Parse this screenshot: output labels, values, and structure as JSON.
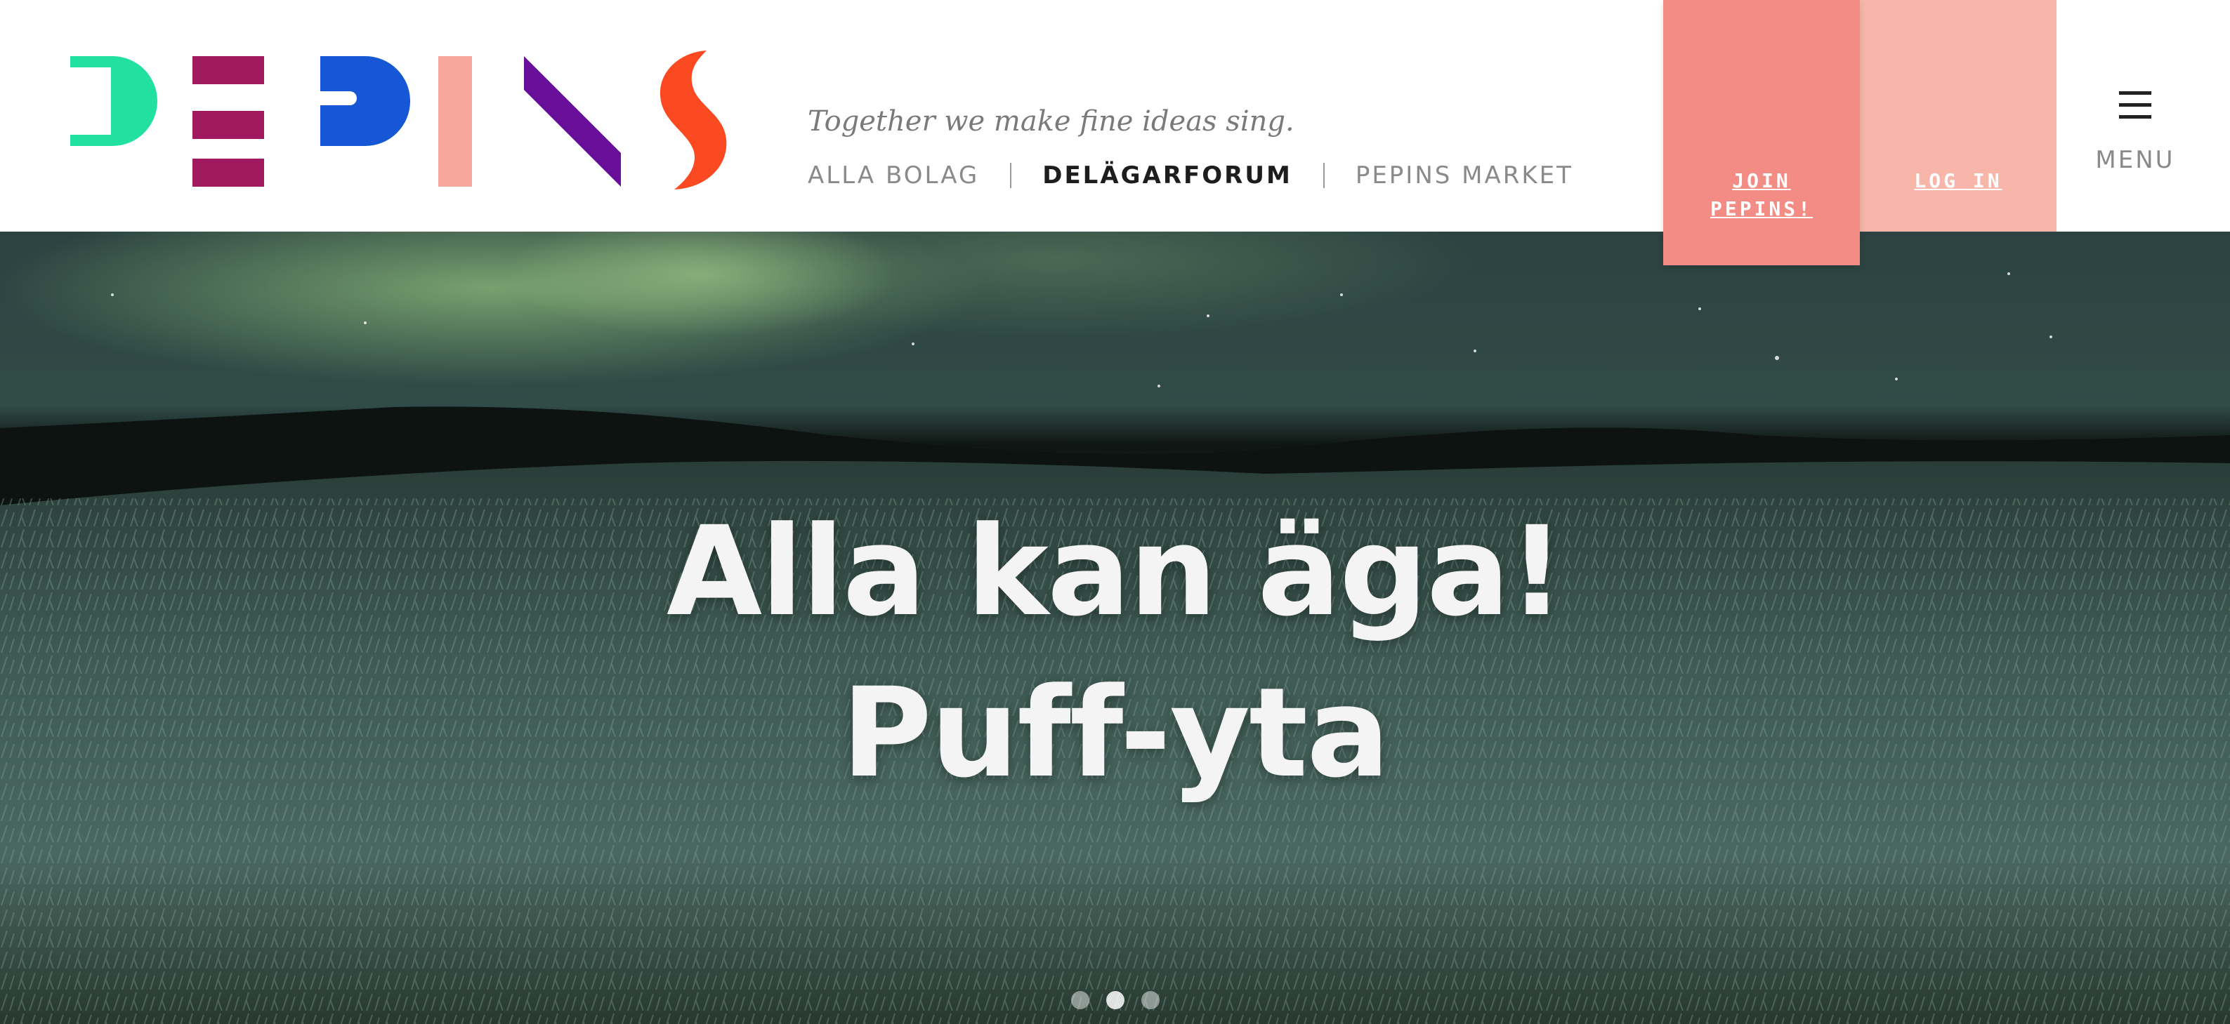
{
  "brand": {
    "logo_text": "PEPINS",
    "colors": {
      "p1": "#22e0a0",
      "e": "#a11a5f",
      "p2": "#1657d6",
      "i": "#f7a89d",
      "n": "#6a0f9a",
      "s": "#fb4a22"
    }
  },
  "header": {
    "tagline": "Together we make fine ideas sing.",
    "nav": [
      {
        "label": "ALLA BOLAG",
        "active": false
      },
      {
        "label": "DELÄGARFORUM",
        "active": true
      },
      {
        "label": "PEPINS MARKET",
        "active": false
      }
    ],
    "join_label": "JOIN PEPINS!",
    "login_label": "LOG IN",
    "menu_label": "MENU",
    "menu_icon": "hamburger-icon",
    "colors": {
      "join_bg": "#f48c86",
      "login_bg": "#f8b6ab"
    }
  },
  "hero": {
    "title_line1": "Alla kan äga!",
    "title_line2": "Puff-yta",
    "slides": 3,
    "active_slide": 1
  }
}
